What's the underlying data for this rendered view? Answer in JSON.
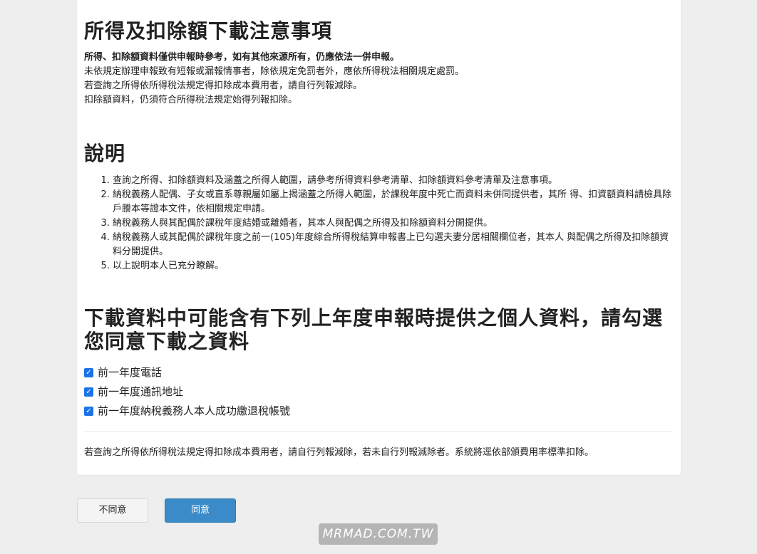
{
  "notice": {
    "title": "所得及扣除額下載注意事項",
    "lines": [
      "所得、扣除額資料僅供申報時參考，如有其他來源所有，仍應依法一併申報。",
      "未依規定辦理申報致有短報或漏報情事者，除依規定免罰者外，應依所得稅法相關規定處罰。",
      "若查詢之所得依所得稅法規定得扣除成本費用者，請自行列報減除。",
      "扣除額資料，仍須符合所得稅法規定始得列報扣除。"
    ]
  },
  "description": {
    "title": "說明",
    "items": [
      "查詢之所得、扣除額資料及涵蓋之所得人範圍，請參考所得資料參考清單、扣除額資料參考清單及注意事項。",
      "納稅義務人配偶、子女或直系尊親屬如屬上揭涵蓋之所得人範圍，於課稅年度中死亡而資料未併同提供者，其所 得、扣資額資料請檢具除戶謄本等證本文件，依相關規定申請。",
      "納稅義務人與其配偶於課稅年度結婚或離婚者，其本人與配偶之所得及扣除額資料分開提供。",
      "納稅義務人或其配偶於課稅年度之前一(105)年度綜合所得稅結算申報書上已勾選夫妻分居相關欄位者，其本人 與配偶之所得及扣除額資料分開提供。",
      "以上說明本人已充分瞭解。"
    ]
  },
  "consent": {
    "title": "下載資料中可能含有下列上年度申報時提供之個人資料，請勾選您同意下載之資料",
    "options": [
      {
        "label": "前一年度電話",
        "checked": true
      },
      {
        "label": "前一年度通訊地址",
        "checked": true
      },
      {
        "label": "前一年度納稅義務人本人成功繳退稅帳號",
        "checked": true
      }
    ]
  },
  "footer_note": "若查詢之所得依所得稅法規定得扣除成本費用者，請自行列報減除，若未自行列報減除者。系統將逕依部頒費用率標準扣除。",
  "buttons": {
    "disagree": "不同意",
    "agree": "同意"
  },
  "watermark": "MRMAD.COM.TW",
  "colors": {
    "background": "#eeeeee",
    "agree_button": "#3a8bc8",
    "checkbox": "#1a73e8"
  }
}
